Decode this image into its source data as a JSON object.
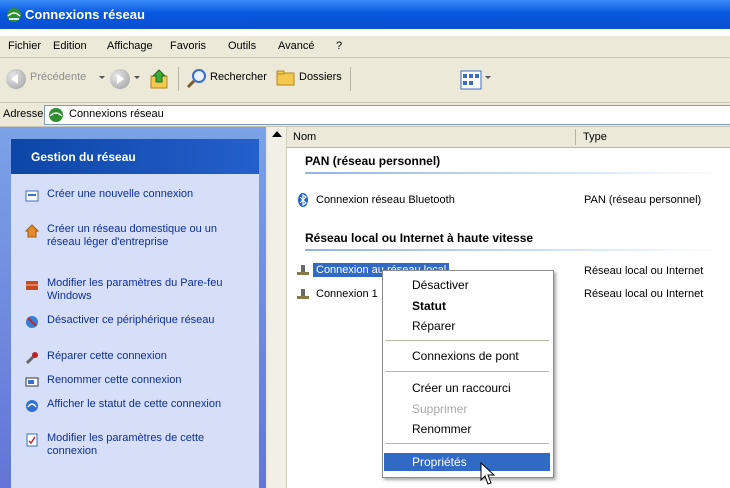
{
  "window": {
    "title": "Connexions réseau"
  },
  "menu": [
    "Fichier",
    "Edition",
    "Affichage",
    "Favoris",
    "Outils",
    "Avancé",
    "?"
  ],
  "toolbar": {
    "back_label": "Précédente",
    "search_label": "Rechercher",
    "folders_label": "Dossiers"
  },
  "address": {
    "label": "Adresse",
    "value": "Connexions réseau"
  },
  "task_pane": {
    "header": "Gestion du réseau",
    "tasks": [
      {
        "label": "Créer une nouvelle connexion",
        "icon": "new-connection-icon"
      },
      {
        "label": "Créer un réseau domestique ou un réseau léger d'entreprise",
        "icon": "home-network-icon"
      },
      {
        "label": "Modifier les paramètres du Pare-feu Windows",
        "icon": "firewall-icon"
      },
      {
        "label": "Désactiver ce périphérique réseau",
        "icon": "disable-device-icon"
      },
      {
        "label": "Réparer cette connexion",
        "icon": "repair-icon"
      },
      {
        "label": "Renommer cette connexion",
        "icon": "rename-icon"
      },
      {
        "label": "Afficher le statut de cette connexion",
        "icon": "status-icon"
      },
      {
        "label": "Modifier les paramètres de cette connexion",
        "icon": "properties-icon"
      }
    ]
  },
  "columns": {
    "name": "Nom",
    "type": "Type"
  },
  "groups": [
    {
      "title": "PAN (réseau personnel)"
    },
    {
      "title": "Réseau local ou Internet à haute vitesse"
    }
  ],
  "rows": [
    {
      "name": "Connexion réseau Bluetooth",
      "type": "PAN (réseau personnel)",
      "icon": "bluetooth-icon"
    },
    {
      "name": "Connexion au réseau local",
      "type": "Réseau local ou Internet",
      "icon": "lan-icon"
    },
    {
      "name": "Connexion 1",
      "type": "Réseau local ou Internet",
      "icon": "lan-icon"
    }
  ],
  "context_menu": [
    {
      "label": "Désactiver"
    },
    {
      "label": "Statut"
    },
    {
      "label": "Réparer"
    },
    {
      "label": "Connexions de pont"
    },
    {
      "label": "Créer un raccourci"
    },
    {
      "label": "Supprimer"
    },
    {
      "label": "Renommer"
    },
    {
      "label": "Propriétés"
    }
  ],
  "colors": {
    "title_bar": "#0858e0",
    "selection": "#316ac5",
    "task_header": "#0c46a6",
    "task_link": "#0c2f99"
  }
}
